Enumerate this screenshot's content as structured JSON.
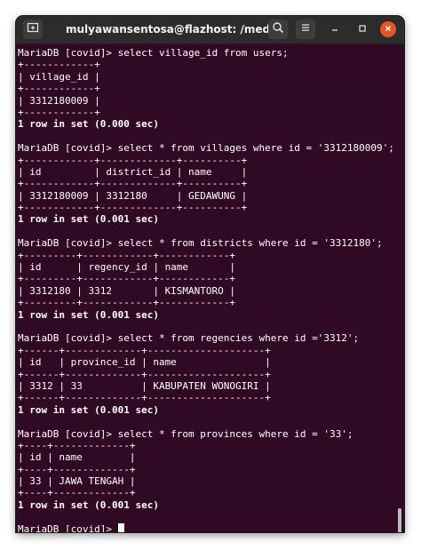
{
  "window": {
    "title": "mulyawansentosa@flazhost: /media/mul..."
  },
  "titlebar": {
    "new_tab_icon": "new-tab-icon",
    "search_icon": "search-icon",
    "menu_icon": "hamburger-menu-icon",
    "minimize_icon": "minimize-icon",
    "maximize_icon": "maximize-icon",
    "close_icon": "close-icon",
    "close_color": "#e95420"
  },
  "terminal": {
    "background": "#300a24",
    "prompt": "MariaDB [covid]> ",
    "lines": [
      "MariaDB [covid]> select village_id from users;",
      "+------------+",
      "| village_id |",
      "+------------+",
      "| 3312180009 |",
      "+------------+",
      "1 row in set (0.000 sec)",
      "",
      "MariaDB [covid]> select * from villages where id = '3312180009';",
      "+------------+-------------+----------+",
      "| id         | district_id | name     |",
      "+------------+-------------+----------+",
      "| 3312180009 | 3312180     | GEDAWUNG |",
      "+------------+-------------+----------+",
      "1 row in set (0.001 sec)",
      "",
      "MariaDB [covid]> select * from districts where id = '3312180';",
      "+---------+------------+------------+",
      "| id      | regency_id | name       |",
      "+---------+------------+------------+",
      "| 3312180 | 3312       | KISMANTORO |",
      "+---------+------------+------------+",
      "1 row in set (0.001 sec)",
      "",
      "MariaDB [covid]> select * from regencies where id ='3312';",
      "+------+-------------+--------------------+",
      "| id   | province_id | name               |",
      "+------+-------------+--------------------+",
      "| 3312 | 33          | KABUPATEN WONOGIRI |",
      "+------+-------------+--------------------+",
      "1 row in set (0.001 sec)",
      "",
      "MariaDB [covid]> select * from provinces where id = '33';",
      "+----+-------------+",
      "| id | name        |",
      "+----+-------------+",
      "| 33 | JAWA TENGAH |",
      "+----+-------------+",
      "1 row in set (0.001 sec)",
      ""
    ]
  }
}
